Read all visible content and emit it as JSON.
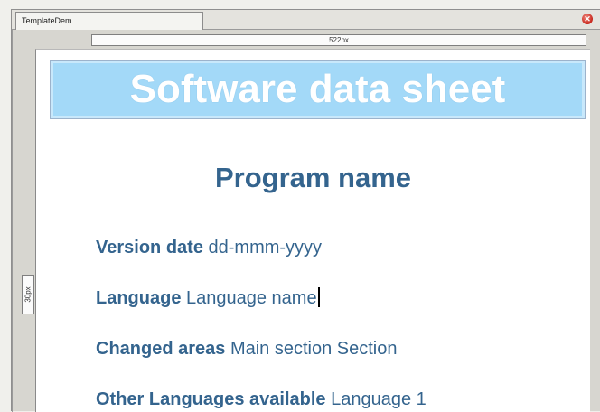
{
  "tab": {
    "title": "TemplateDem"
  },
  "rulers": {
    "horizontal": "522px",
    "vertical": "30px"
  },
  "document": {
    "banner_title": "Software data sheet",
    "program_name": "Program name",
    "fields": [
      {
        "label": "Version date",
        "value": "dd-mmm-yyyy"
      },
      {
        "label": "Language",
        "value": "Language name"
      },
      {
        "label": "Changed areas",
        "value": "Main section Section"
      },
      {
        "label": "Other Languages available",
        "value": "Language 1"
      }
    ]
  },
  "icons": {
    "close": "close-icon"
  },
  "colors": {
    "banner": "#a3d9f8",
    "heading": "#34648e",
    "close": "#c7261b"
  }
}
